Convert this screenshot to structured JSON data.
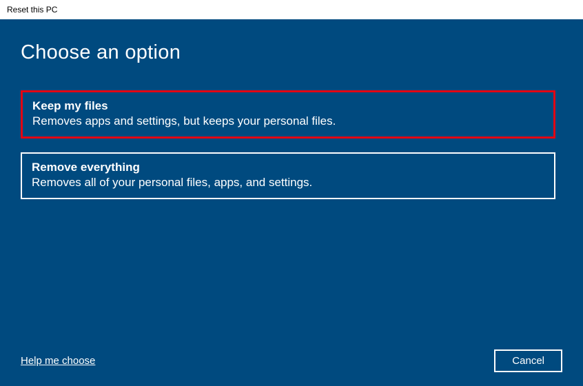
{
  "window": {
    "title": "Reset this PC"
  },
  "page": {
    "heading": "Choose an option"
  },
  "options": {
    "keep_files": {
      "title": "Keep my files",
      "description": "Removes apps and settings, but keeps your personal files."
    },
    "remove_everything": {
      "title": "Remove everything",
      "description": "Removes all of your personal files, apps, and settings."
    }
  },
  "footer": {
    "help_link": "Help me choose",
    "cancel_label": "Cancel"
  }
}
